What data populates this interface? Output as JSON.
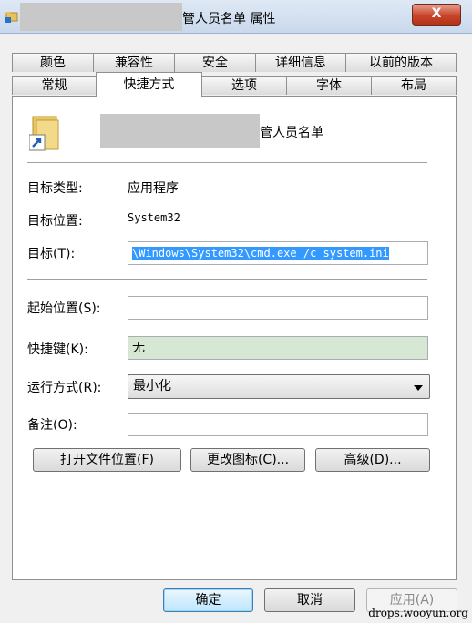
{
  "window": {
    "title": "管人员名单 属性",
    "close_label": "X"
  },
  "tabs": {
    "row_back": [
      "颜色",
      "兼容性",
      "安全",
      "详细信息",
      "以前的版本"
    ],
    "row_front": [
      "常规",
      "快捷方式",
      "选项",
      "字体",
      "布局"
    ],
    "active": "快捷方式"
  },
  "shortcut": {
    "name": "管人员名单",
    "target_type_label": "目标类型:",
    "target_type_value": "应用程序",
    "target_location_label": "目标位置:",
    "target_location_value": "System32",
    "target_label": "目标(T):",
    "target_value": "\\Windows\\System32\\cmd.exe /c system.ini",
    "start_in_label": "起始位置(S):",
    "start_in_value": "",
    "hotkey_label": "快捷键(K):",
    "hotkey_value": "无",
    "run_label": "运行方式(R):",
    "run_value": "最小化",
    "comment_label": "备注(O):",
    "comment_value": ""
  },
  "buttons": {
    "open_location": "打开文件位置(F)",
    "change_icon": "更改图标(C)...",
    "advanced": "高级(D)...",
    "ok": "确定",
    "cancel": "取消",
    "apply": "应用(A)"
  },
  "watermark": "drops.wooyun.org"
}
